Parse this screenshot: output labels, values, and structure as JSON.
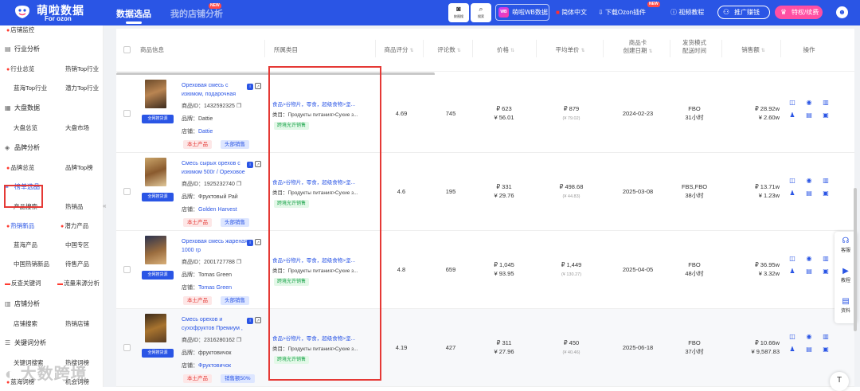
{
  "header": {
    "logo_cn": "萌啦数据",
    "logo_en": "For ozon",
    "tab_active": "数据选品",
    "tab_other": "我的店铺分析",
    "new_badge": "NEW",
    "search_img": "按图搜",
    "search": "搜索",
    "wb_btn": "萌啦WB数据",
    "wb_mark": "WB",
    "lang": "简体中文",
    "plugin": "下载Ozon插件",
    "plugin_badge": "NEW",
    "tutorial": "视频教程",
    "promo": "推广赚钱",
    "vip": "特权/续费"
  },
  "sidebar": {
    "top_item": "店铺监控",
    "sections": [
      {
        "title": "行业分析",
        "items": [
          "行业总览",
          "热销Top行业",
          "蓝海Top行业",
          "潜力Top行业"
        ]
      },
      {
        "title": "大盘数据",
        "items": [
          "大盘总览",
          "大盘市场"
        ]
      },
      {
        "title": "品牌分析",
        "items": [
          "品牌总览",
          "品牌Top榜"
        ]
      },
      {
        "title": "榜单选品",
        "items": [
          "产品搜索",
          "热销品",
          "热销新品",
          "潜力产品",
          "蓝海产品",
          "中国专区",
          "中国热销新品",
          "待售产品",
          "反查关键词",
          "流量来源分析"
        ]
      },
      {
        "title": "店铺分析",
        "items": [
          "店铺搜索",
          "热销店铺"
        ]
      },
      {
        "title": "关键词分析",
        "items": [
          "关键词搜索",
          "热搜词榜",
          "蓝海词榜",
          "机会词榜"
        ]
      }
    ],
    "collapse": "«"
  },
  "table": {
    "headers": {
      "product": "商品信息",
      "category": "所属类目",
      "rating": "商品评分",
      "reviews": "评论数",
      "price": "价格",
      "avg_price": "平均单价",
      "created": "商品卡\n创建日期",
      "ship": "发货模式\n配送时间",
      "sales": "销售额",
      "ops": "操作"
    },
    "labels": {
      "id": "商品ID：",
      "brand": "品牌：",
      "shop": "店铺：",
      "cat_prefix": "类目：",
      "source": "全网搜货源",
      "local": "本土产品",
      "cross": "跨境允许销售"
    },
    "rows": [
      {
        "name": "Ореховая смесь с изюмом, подарочная упаковк...",
        "id": "1432592325",
        "brand": "Dattie",
        "shop": "Dattie",
        "tag2": "头部销售",
        "cat": "食品>谷物片，零食，超级食物>坚...",
        "cat_ru": "Продукты питания>Сухие з...",
        "rating": "4.69",
        "reviews": "745",
        "price_rub": "₽ 623",
        "price_cny": "¥ 56.01",
        "avg_rub": "₽ 879",
        "avg_cny": "(¥ 79.02)",
        "created": "2024-02-23",
        "ship": "FBO",
        "ship_time": "31小时",
        "sales_rub": "₽ 28.92w",
        "sales_cny": "¥ 2.60w"
      },
      {
        "name": "Смесь сырых орехов с изюмом 500г / Ореховое ...",
        "id": "1925232740",
        "brand": "Фруктовый Рай",
        "shop": "Golden Harvest",
        "tag2": "头部销售",
        "cat": "食品>谷物片，零食，超级食物>坚...",
        "cat_ru": "Продукты питания>Сухие з...",
        "rating": "4.6",
        "reviews": "195",
        "price_rub": "₽ 331",
        "price_cny": "¥ 29.76",
        "avg_rub": "₽ 498.68",
        "avg_cny": "(¥ 44.83)",
        "created": "2025-03-08",
        "ship": "FBS,FBO",
        "ship_time": "38小时",
        "sales_rub": "₽ 13.71w",
        "sales_cny": "¥ 1.23w"
      },
      {
        "name": "Ореховая смесь жареная 1000 гр",
        "id": "2001727788",
        "brand": "Tomas Green",
        "shop": "Tomas Green",
        "tag2": "头部销售",
        "cat": "食品>谷物片，零食，超级食物>坚...",
        "cat_ru": "Продукты питания>Сухие з...",
        "rating": "4.8",
        "reviews": "659",
        "price_rub": "₽ 1,045",
        "price_cny": "¥ 93.95",
        "avg_rub": "₽ 1,449",
        "avg_cny": "(¥ 130.27)",
        "created": "2025-04-05",
        "ship": "FBO",
        "ship_time": "48小时",
        "sales_rub": "₽ 36.95w",
        "sales_cny": "¥ 3.32w"
      },
      {
        "name": "Смесь орехов и сухофруктов Премиум , подаро...",
        "id": "2316280162",
        "brand": "фруктовичок",
        "shop": "Фруктовичок",
        "tag2": "销售额50%",
        "cat": "食品>谷物片，零食，超级食物>坚...",
        "cat_ru": "Продукты питания>Сухие з...",
        "rating": "4.19",
        "reviews": "427",
        "price_rub": "₽ 311",
        "price_cny": "¥ 27.96",
        "avg_rub": "₽ 450",
        "avg_cny": "(¥ 40.46)",
        "created": "2025-06-18",
        "ship": "FBO",
        "ship_time": "37小时",
        "sales_rub": "₽ 10.66w",
        "sales_cny": "¥ 9,587.83"
      }
    ]
  },
  "float": {
    "service": "客服",
    "tutorial": "教程",
    "docs": "资料",
    "top": "T"
  },
  "watermark": "大数跨境",
  "colors": {
    "brand": "#2a55e5",
    "highlight": "#e53935",
    "pink": "#ff4fa3"
  }
}
